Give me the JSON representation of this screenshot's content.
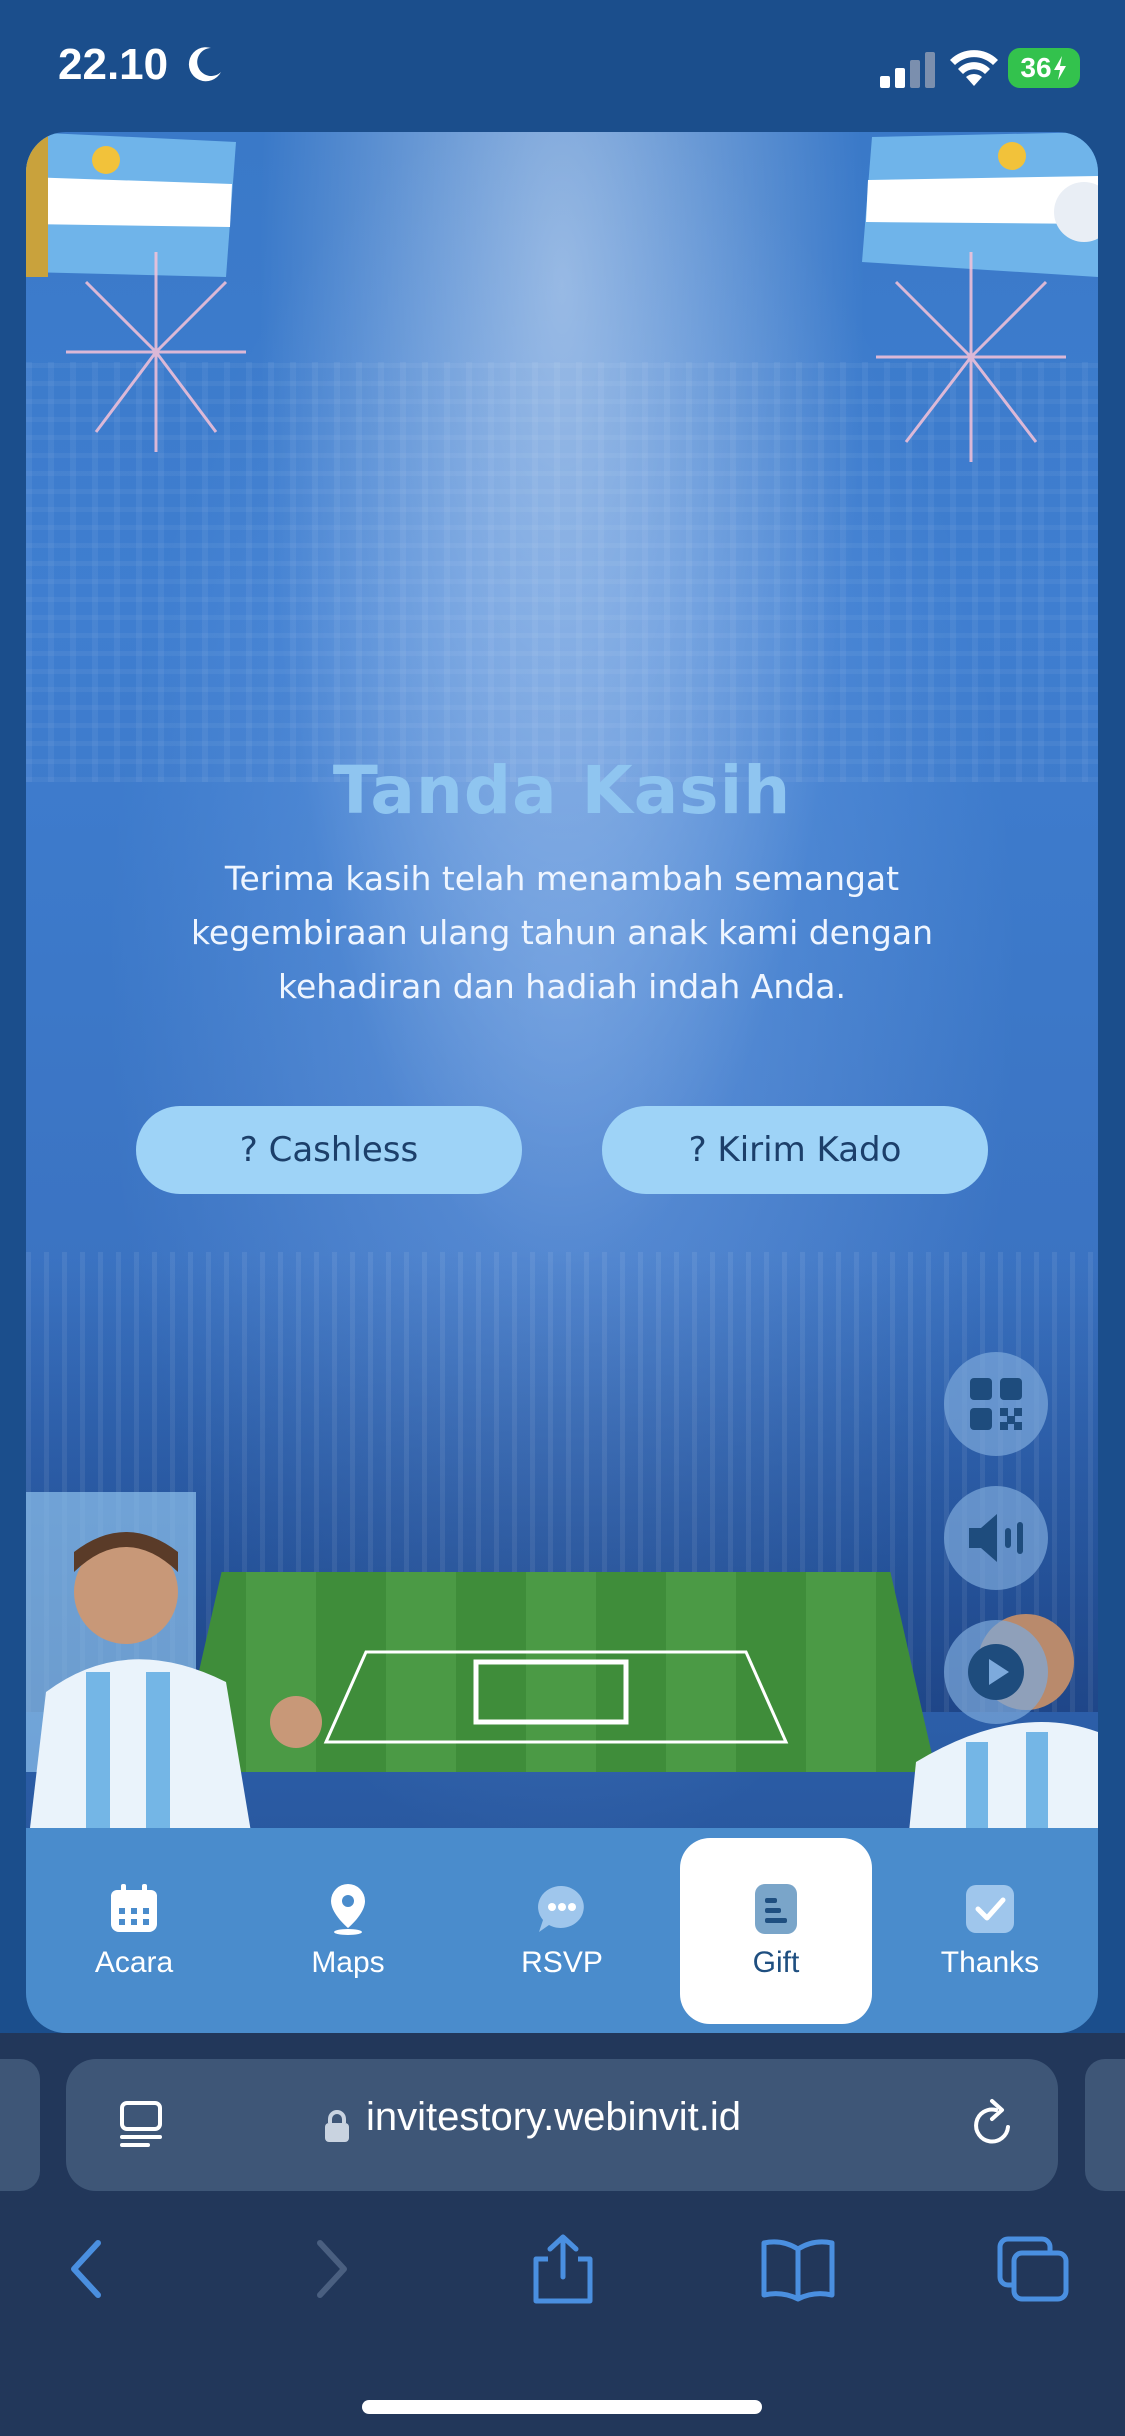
{
  "status_bar": {
    "time": "22.10",
    "battery": "36"
  },
  "content": {
    "title": "Tanda Kasih",
    "message": "Terima kasih telah menambah semangat kegembiraan ulang tahun anak kami dengan kehadiran dan hadiah indah Anda.",
    "buttons": {
      "cashless": "? Cashless",
      "kirim_kado": "? Kirim Kado"
    }
  },
  "floating_buttons": [
    "qr-code-icon",
    "speaker-icon",
    "play-icon"
  ],
  "bottom_nav": {
    "items": [
      {
        "label": "Acara",
        "icon": "calendar-icon"
      },
      {
        "label": "Maps",
        "icon": "map-pin-icon"
      },
      {
        "label": "RSVP",
        "icon": "chat-icon"
      },
      {
        "label": "Gift",
        "icon": "document-icon",
        "active": true
      },
      {
        "label": "Thanks",
        "icon": "checkbox-icon"
      }
    ]
  },
  "browser": {
    "url": "invitestory.webinvit.id"
  },
  "colors": {
    "accent": "#9ed3f7",
    "nav_bg": "#4a8ccc",
    "title": "#8fc5f0",
    "browser_bg": "#22375a",
    "toolbar_icon": "#4a8fe0"
  }
}
